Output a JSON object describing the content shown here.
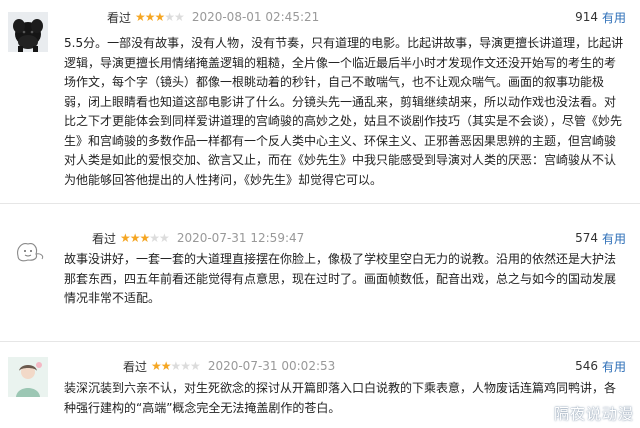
{
  "reviews": [
    {
      "seen_label": "看过",
      "rating": 3,
      "time": "2020-08-01 02:45:21",
      "votes": "914",
      "useful_label": "有用",
      "text": "5.5分。一部没有故事，没有人物，没有节奏，只有道理的电影。比起讲故事，导演更擅长讲道理，比起讲逻辑，导演更擅长用情绪掩盖逻辑的粗糙，全片像一个临近最后半小时才发现作文还没开始写的考生的考场作文，每个字（镜头）都像一根眺动着的秒针，自己不敢喘气，也不让观众喘气。画面的叙事功能极弱，闭上眼睛看也知道这部电影讲了什么。分镜头先一通乱来，剪辑继续胡来，所以动作戏也没法看。对比之下才更能体会到同样爱讲道理的宫崎骏的高妙之处，姑且不谈剧作技巧（其实是不会谈），尽管《妙先生》和宫崎骏的多数作品一样都有一个反人类中心主义、环保主义、正邪善恶因果思辨的主题，但宫崎骏对人类是如此的爱恨交加、欲言又止，而在《妙先生》中我只能感受到导演对人类的厌恶：宫崎骏从不认为他能够回答他提出的人性拷问，《妙先生》却觉得它可以。"
    },
    {
      "seen_label": "看过",
      "rating": 3,
      "time": "2020-07-31 12:59:47",
      "votes": "574",
      "useful_label": "有用",
      "text": "故事没讲好，一套一套的大道理直接摆在你脸上，像极了学校里空白无力的说教。沿用的依然还是大护法那套东西，四五年前看还能觉得有点意思，现在过时了。画面帧数低，配音出戏，总之与如今的国动发展情况非常不适配。"
    },
    {
      "seen_label": "看过",
      "rating": 2,
      "time": "2020-07-31 00:02:53",
      "votes": "546",
      "useful_label": "有用",
      "text": "装深沉装到六亲不认，对生死欲念的探讨从开篇即落入口白说教的下乘表意，人物废话连篇鸡同鸭讲，各种强行建构的“高端”概念完全无法掩盖剧作的苍白。"
    }
  ],
  "watermark": "隔夜说动漫",
  "colors": {
    "star": "#f5a623",
    "useful": "#2e6fb8",
    "time": "#999999"
  }
}
